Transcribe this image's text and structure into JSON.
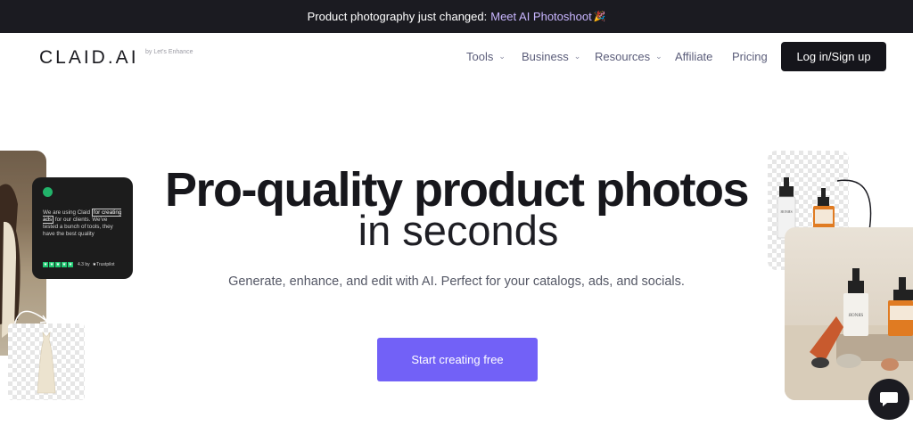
{
  "announcement": {
    "text": "Product photography just changed:",
    "link": "Meet AI Photoshoot",
    "emoji": "🎉"
  },
  "nav": {
    "logo": "CLAID.AI",
    "logo_sub": "by Let's Enhance",
    "items": [
      {
        "label": "Tools",
        "dropdown": true
      },
      {
        "label": "Business",
        "dropdown": true
      },
      {
        "label": "Resources",
        "dropdown": true
      },
      {
        "label": "Affiliate",
        "dropdown": false
      },
      {
        "label": "Pricing",
        "dropdown": false
      }
    ],
    "login": "Log in/Sign up"
  },
  "hero": {
    "title_line1": "Pro-quality product photos",
    "title_line2": "in seconds",
    "subtitle": "Generate, enhance, and edit with AI. Perfect for your catalogs, ads, and socials.",
    "cta": "Start creating free"
  },
  "review": {
    "text_before": "We are using Claid",
    "highlight": "for creating ads",
    "text_after": "for our clients. We've tested a bunch of tools, they have the best quality",
    "rating": "4.3 by",
    "platform": "Trustpilot",
    "star_color": "#1ec770"
  },
  "bottles": {
    "label": "ЯОNЯS"
  },
  "colors": {
    "accent": "#7261f7",
    "dark": "#1b1b21",
    "link_highlight": "#c9b6ff"
  },
  "icons": {
    "chat": "chat-bubble-icon",
    "chevron": "chevron-down-icon"
  }
}
